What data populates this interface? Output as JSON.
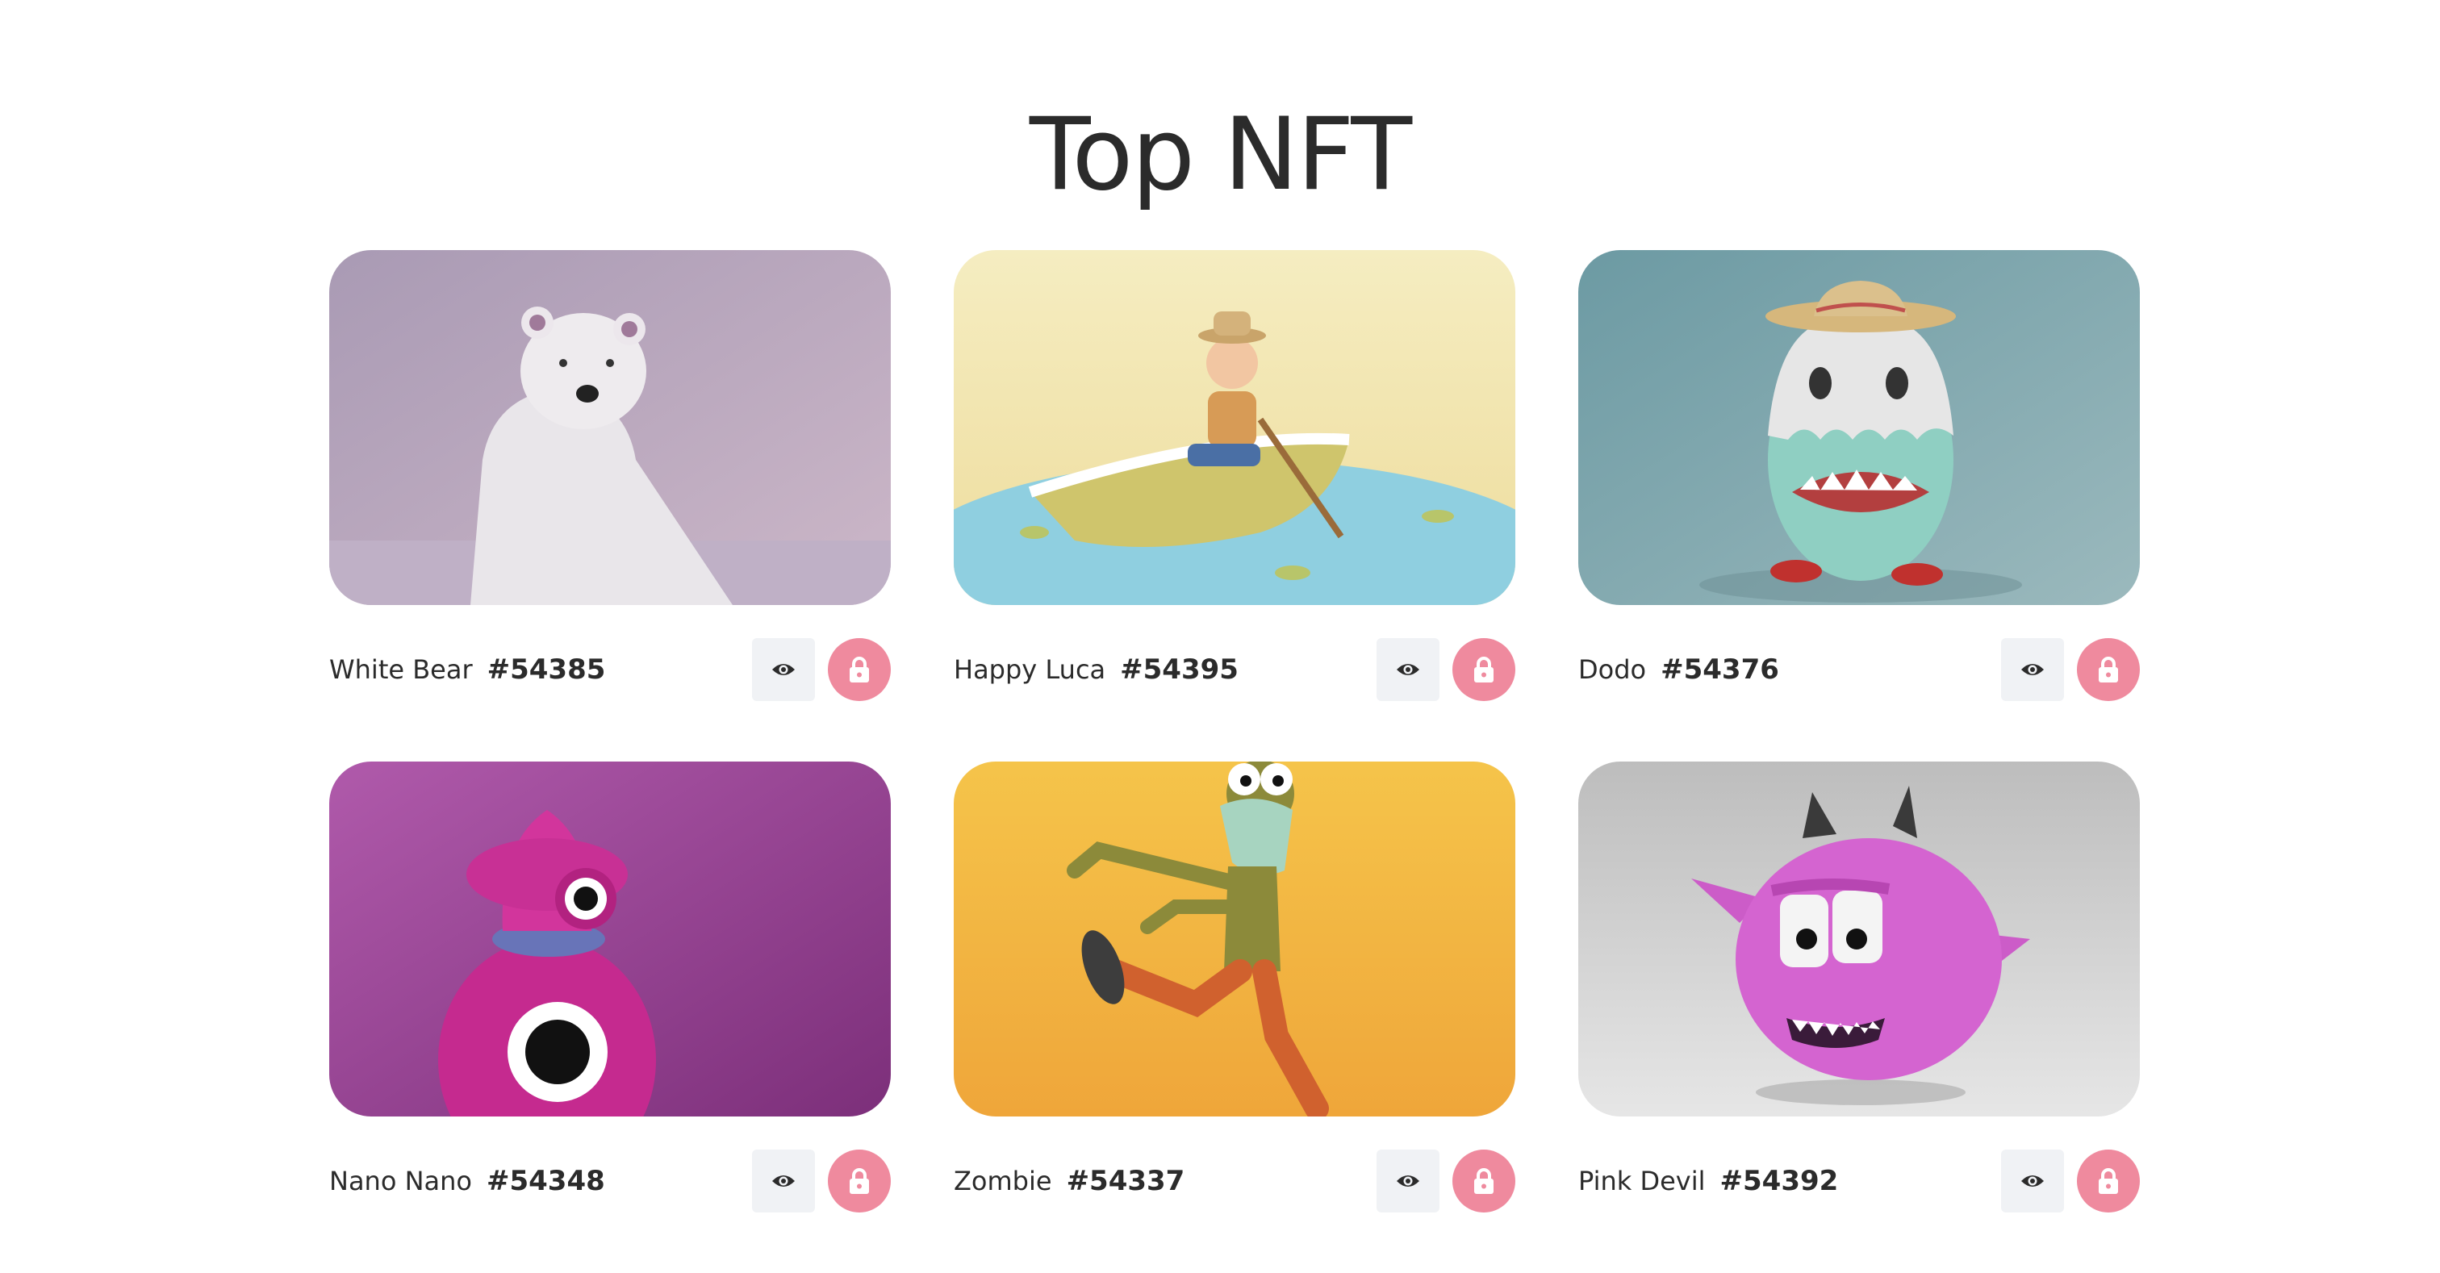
{
  "page": {
    "title": "Top NFT"
  },
  "colors": {
    "view_button_bg": "#f0f2f5",
    "lock_button_bg": "#ef8a9e",
    "text": "#2b2b2b"
  },
  "nfts": [
    {
      "name": "White Bear",
      "id": "#54385",
      "image": "white-bear-image",
      "bg": "#b7a8c0"
    },
    {
      "name": "Happy Luca",
      "id": "#54395",
      "image": "happy-luca-image",
      "bg": "#f1e7b4"
    },
    {
      "name": "Dodo",
      "id": "#54376",
      "image": "dodo-image",
      "bg": "#7aa6ad"
    },
    {
      "name": "Nano Nano",
      "id": "#54348",
      "image": "nano-nano-image",
      "bg": "#9b3d93"
    },
    {
      "name": "Zombie",
      "id": "#54337",
      "image": "zombie-image",
      "bg": "#f2b93f"
    },
    {
      "name": "Pink Devil",
      "id": "#54392",
      "image": "pink-devil-image",
      "bg": "#cfcfcf"
    }
  ]
}
